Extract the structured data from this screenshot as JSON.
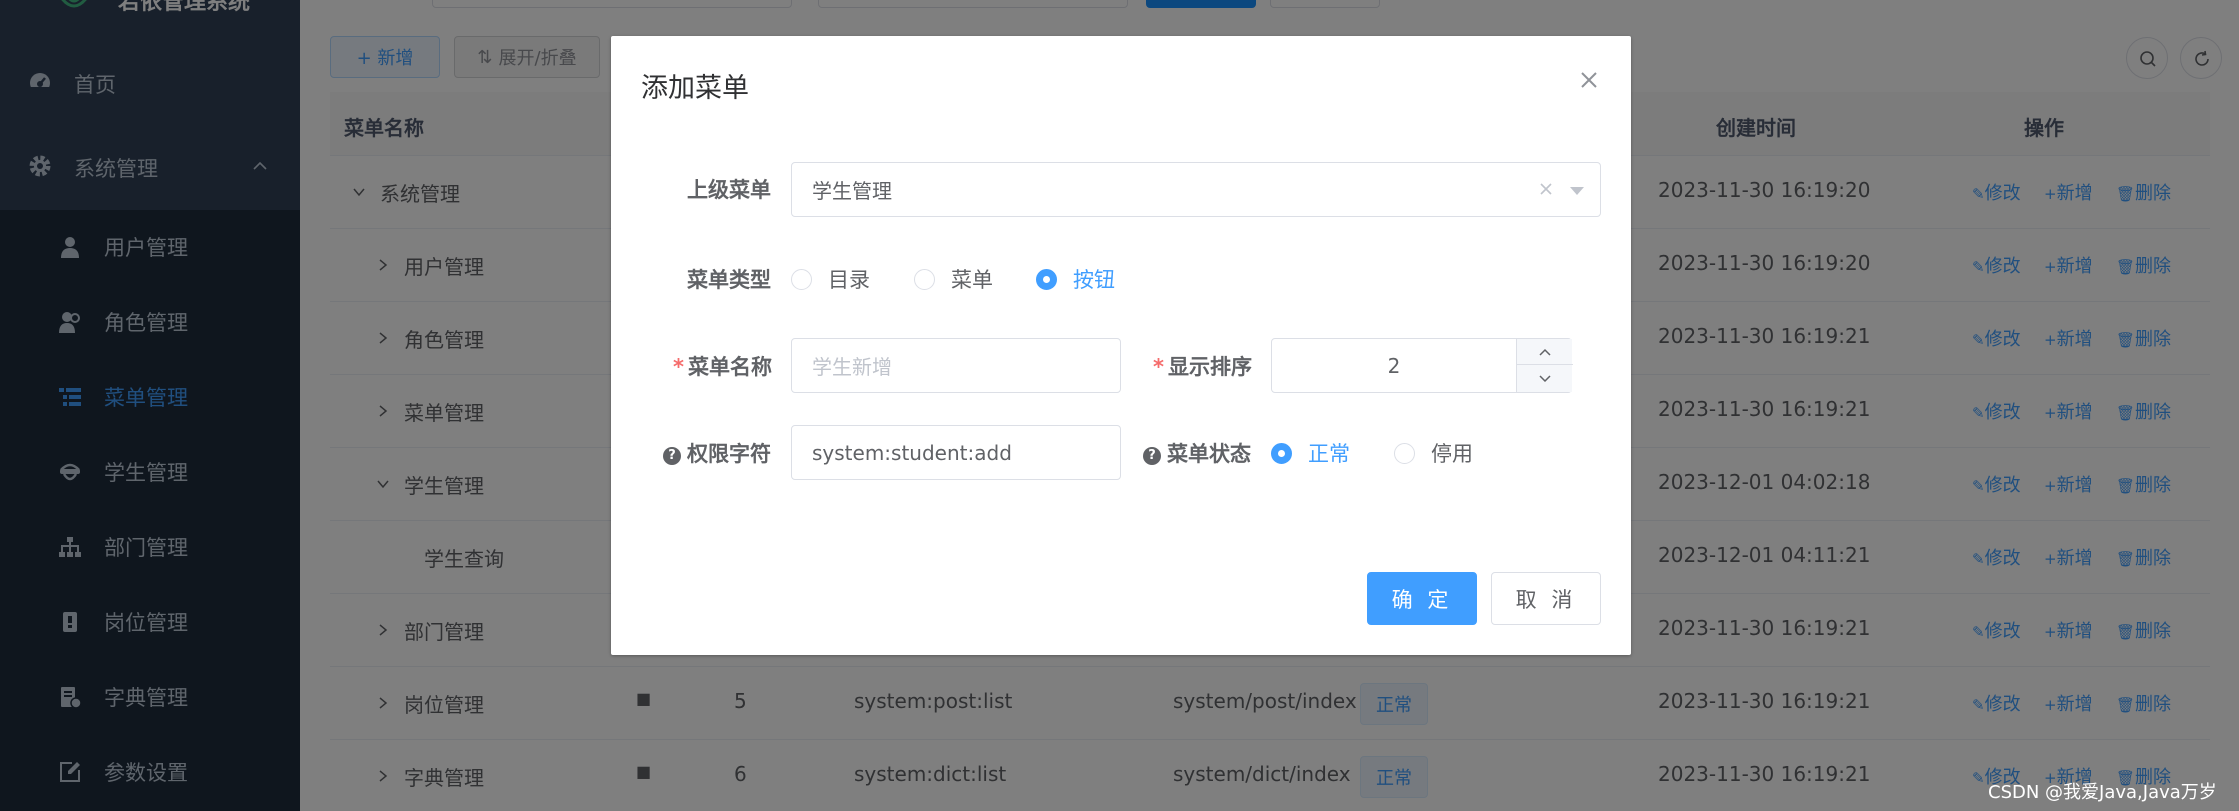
{
  "app": {
    "logo_text": "若依管理系统"
  },
  "sidebar": {
    "top_items": [
      {
        "label": "首页",
        "icon": "dashboard-icon"
      },
      {
        "label": "系统管理",
        "icon": "gear-icon"
      }
    ],
    "sub_items": [
      {
        "label": "用户管理",
        "icon": "user-icon"
      },
      {
        "label": "角色管理",
        "icon": "peoples-icon"
      },
      {
        "label": "菜单管理",
        "icon": "tree-table-icon",
        "active": true
      },
      {
        "label": "学生管理",
        "icon": "student-icon"
      },
      {
        "label": "部门管理",
        "icon": "tree-icon"
      },
      {
        "label": "岗位管理",
        "icon": "post-icon"
      },
      {
        "label": "字典管理",
        "icon": "dict-icon"
      },
      {
        "label": "参数设置",
        "icon": "edit-icon"
      }
    ]
  },
  "toolbar": {
    "add_label": "+ 新增",
    "expand_label": "展开/折叠"
  },
  "table": {
    "headers": {
      "name": "菜单名称",
      "created": "创建时间",
      "ops": "操作"
    },
    "rows": [
      {
        "name": "系统管理",
        "created": "2023-11-30 16:19:20",
        "expanded": true
      },
      {
        "name": "用户管理",
        "created": "2023-11-30 16:19:20"
      },
      {
        "name": "角色管理",
        "created": "2023-11-30 16:19:21"
      },
      {
        "name": "菜单管理",
        "created": "2023-11-30 16:19:21"
      },
      {
        "name": "学生管理",
        "created": "2023-12-01 04:02:18",
        "expanded": true
      },
      {
        "name": "学生查询",
        "created": "2023-12-01 04:11:21"
      },
      {
        "name": "部门管理",
        "created": "2023-11-30 16:19:21"
      },
      {
        "name": "岗位管理",
        "order": "5",
        "perm": "system:post:list",
        "component": "system/post/index",
        "status": "正常",
        "created": "2023-11-30 16:19:21"
      },
      {
        "name": "字典管理",
        "order": "6",
        "perm": "system:dict:list",
        "component": "system/dict/index",
        "status": "正常",
        "created": "2023-11-30 16:19:21"
      }
    ],
    "op_edit": "修改",
    "op_add": "新增",
    "op_delete": "删除"
  },
  "dialog": {
    "title": "添加菜单",
    "parent_label": "上级菜单",
    "parent_value": "学生管理",
    "type_label": "菜单类型",
    "type_options": [
      "目录",
      "菜单",
      "按钮"
    ],
    "type_selected": "按钮",
    "name_label": "菜单名称",
    "name_placeholder": "学生新增",
    "order_label": "显示排序",
    "order_value": "2",
    "perm_label": "权限字符",
    "perm_value": "system:student:add",
    "status_label": "菜单状态",
    "status_options": [
      "正常",
      "停用"
    ],
    "status_selected": "正常",
    "confirm_label": "确 定",
    "cancel_label": "取 消"
  },
  "watermark": "CSDN @我爱Java,Java万岁",
  "colors": {
    "primary": "#409eff",
    "sidebar": "#304156",
    "submenu": "#1f2d3d",
    "required": "#f56c6c"
  }
}
